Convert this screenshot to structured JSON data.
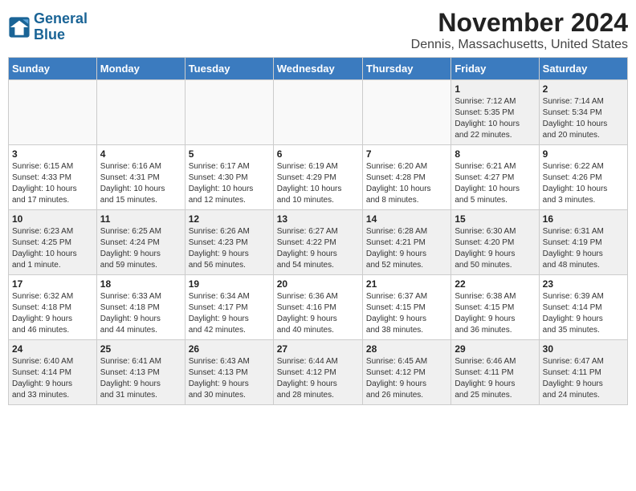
{
  "logo": {
    "text_line1": "General",
    "text_line2": "Blue"
  },
  "title": "November 2024",
  "subtitle": "Dennis, Massachusetts, United States",
  "days_of_week": [
    "Sunday",
    "Monday",
    "Tuesday",
    "Wednesday",
    "Thursday",
    "Friday",
    "Saturday"
  ],
  "weeks": [
    [
      {
        "day": "",
        "info": ""
      },
      {
        "day": "",
        "info": ""
      },
      {
        "day": "",
        "info": ""
      },
      {
        "day": "",
        "info": ""
      },
      {
        "day": "",
        "info": ""
      },
      {
        "day": "1",
        "info": "Sunrise: 7:12 AM\nSunset: 5:35 PM\nDaylight: 10 hours\nand 22 minutes."
      },
      {
        "day": "2",
        "info": "Sunrise: 7:14 AM\nSunset: 5:34 PM\nDaylight: 10 hours\nand 20 minutes."
      }
    ],
    [
      {
        "day": "3",
        "info": "Sunrise: 6:15 AM\nSunset: 4:33 PM\nDaylight: 10 hours\nand 17 minutes."
      },
      {
        "day": "4",
        "info": "Sunrise: 6:16 AM\nSunset: 4:31 PM\nDaylight: 10 hours\nand 15 minutes."
      },
      {
        "day": "5",
        "info": "Sunrise: 6:17 AM\nSunset: 4:30 PM\nDaylight: 10 hours\nand 12 minutes."
      },
      {
        "day": "6",
        "info": "Sunrise: 6:19 AM\nSunset: 4:29 PM\nDaylight: 10 hours\nand 10 minutes."
      },
      {
        "day": "7",
        "info": "Sunrise: 6:20 AM\nSunset: 4:28 PM\nDaylight: 10 hours\nand 8 minutes."
      },
      {
        "day": "8",
        "info": "Sunrise: 6:21 AM\nSunset: 4:27 PM\nDaylight: 10 hours\nand 5 minutes."
      },
      {
        "day": "9",
        "info": "Sunrise: 6:22 AM\nSunset: 4:26 PM\nDaylight: 10 hours\nand 3 minutes."
      }
    ],
    [
      {
        "day": "10",
        "info": "Sunrise: 6:23 AM\nSunset: 4:25 PM\nDaylight: 10 hours\nand 1 minute."
      },
      {
        "day": "11",
        "info": "Sunrise: 6:25 AM\nSunset: 4:24 PM\nDaylight: 9 hours\nand 59 minutes."
      },
      {
        "day": "12",
        "info": "Sunrise: 6:26 AM\nSunset: 4:23 PM\nDaylight: 9 hours\nand 56 minutes."
      },
      {
        "day": "13",
        "info": "Sunrise: 6:27 AM\nSunset: 4:22 PM\nDaylight: 9 hours\nand 54 minutes."
      },
      {
        "day": "14",
        "info": "Sunrise: 6:28 AM\nSunset: 4:21 PM\nDaylight: 9 hours\nand 52 minutes."
      },
      {
        "day": "15",
        "info": "Sunrise: 6:30 AM\nSunset: 4:20 PM\nDaylight: 9 hours\nand 50 minutes."
      },
      {
        "day": "16",
        "info": "Sunrise: 6:31 AM\nSunset: 4:19 PM\nDaylight: 9 hours\nand 48 minutes."
      }
    ],
    [
      {
        "day": "17",
        "info": "Sunrise: 6:32 AM\nSunset: 4:18 PM\nDaylight: 9 hours\nand 46 minutes."
      },
      {
        "day": "18",
        "info": "Sunrise: 6:33 AM\nSunset: 4:18 PM\nDaylight: 9 hours\nand 44 minutes."
      },
      {
        "day": "19",
        "info": "Sunrise: 6:34 AM\nSunset: 4:17 PM\nDaylight: 9 hours\nand 42 minutes."
      },
      {
        "day": "20",
        "info": "Sunrise: 6:36 AM\nSunset: 4:16 PM\nDaylight: 9 hours\nand 40 minutes."
      },
      {
        "day": "21",
        "info": "Sunrise: 6:37 AM\nSunset: 4:15 PM\nDaylight: 9 hours\nand 38 minutes."
      },
      {
        "day": "22",
        "info": "Sunrise: 6:38 AM\nSunset: 4:15 PM\nDaylight: 9 hours\nand 36 minutes."
      },
      {
        "day": "23",
        "info": "Sunrise: 6:39 AM\nSunset: 4:14 PM\nDaylight: 9 hours\nand 35 minutes."
      }
    ],
    [
      {
        "day": "24",
        "info": "Sunrise: 6:40 AM\nSunset: 4:14 PM\nDaylight: 9 hours\nand 33 minutes."
      },
      {
        "day": "25",
        "info": "Sunrise: 6:41 AM\nSunset: 4:13 PM\nDaylight: 9 hours\nand 31 minutes."
      },
      {
        "day": "26",
        "info": "Sunrise: 6:43 AM\nSunset: 4:13 PM\nDaylight: 9 hours\nand 30 minutes."
      },
      {
        "day": "27",
        "info": "Sunrise: 6:44 AM\nSunset: 4:12 PM\nDaylight: 9 hours\nand 28 minutes."
      },
      {
        "day": "28",
        "info": "Sunrise: 6:45 AM\nSunset: 4:12 PM\nDaylight: 9 hours\nand 26 minutes."
      },
      {
        "day": "29",
        "info": "Sunrise: 6:46 AM\nSunset: 4:11 PM\nDaylight: 9 hours\nand 25 minutes."
      },
      {
        "day": "30",
        "info": "Sunrise: 6:47 AM\nSunset: 4:11 PM\nDaylight: 9 hours\nand 24 minutes."
      }
    ]
  ]
}
